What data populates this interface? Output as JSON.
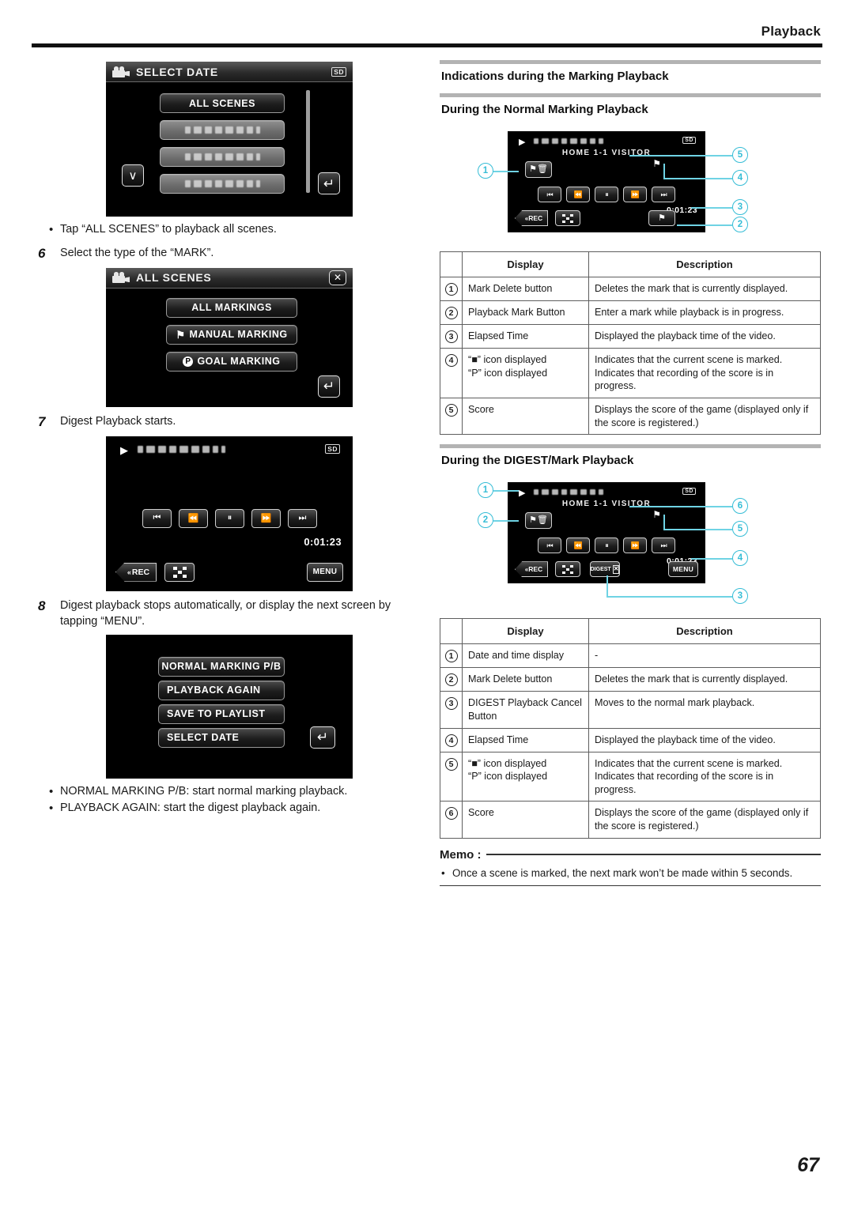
{
  "header": {
    "title": "Playback"
  },
  "footer": {
    "page_number": "67"
  },
  "left_column": {
    "screen_select_date": {
      "title": "SELECT DATE",
      "sd_badge": "SD",
      "all_scenes_label": "ALL SCENES",
      "down_arrow": "∨",
      "return_icon": "return-arrow"
    },
    "note_all_scenes": "Tap “ALL SCENES” to playback all scenes.",
    "step6": {
      "number": "6",
      "text": "Select the type of the “MARK”."
    },
    "screen_all_scenes": {
      "title": "ALL SCENES",
      "close_icon": "✕",
      "buttons": [
        "ALL MARKINGS",
        "MANUAL MARKING",
        "GOAL MARKING"
      ],
      "manual_icon": "flag-icon",
      "goal_icon": "P"
    },
    "step7": {
      "number": "7",
      "text": "Digest Playback starts."
    },
    "screen_digest_playback": {
      "sd_badge": "SD",
      "play_icon": "▶",
      "transport": [
        "⏮",
        "⏪",
        "⏸",
        "⏩",
        "⏭"
      ],
      "elapsed_time": "0:01:23",
      "rec_label": "REC",
      "menu_label": "MENU",
      "grid_icon": "index-grid-icon"
    },
    "step8": {
      "number": "8",
      "text": "Digest playback stops automatically, or display the next screen by tapping “MENU”."
    },
    "screen_after_digest": {
      "buttons": [
        "NORMAL MARKING P/B",
        "PLAYBACK AGAIN",
        "SAVE TO PLAYLIST",
        "SELECT DATE"
      ],
      "return_icon": "return-arrow"
    },
    "notes": [
      "NORMAL MARKING P/B: start normal marking playback.",
      "PLAYBACK AGAIN: start the digest playback again."
    ]
  },
  "right_column": {
    "heading_main": "Indications during the Marking Playback",
    "heading_normal": "During the Normal Marking Playback",
    "heading_digest": "During the DIGEST/Mark Playback",
    "screen_normal": {
      "play_icon": "▶",
      "sd_badge": "SD",
      "score_text": "HOME  1-1  VISITOR",
      "elapsed_time": "0:01:23",
      "rec_label": "REC",
      "transport": [
        "⏮",
        "⏪",
        "⏸",
        "⏩",
        "⏭"
      ],
      "callouts": [
        "1",
        "2",
        "3",
        "4",
        "5"
      ]
    },
    "screen_digest": {
      "play_icon": "▶",
      "sd_badge": "SD",
      "score_text": "HOME  1-1  VISITOR",
      "elapsed_time": "0:01:23",
      "rec_label": "REC",
      "digest_label": "DIGEST",
      "digest_cancel_icon": "✕",
      "menu_label": "MENU",
      "transport": [
        "⏮",
        "⏪",
        "⏸",
        "⏩",
        "⏭"
      ],
      "callouts": [
        "1",
        "2",
        "3",
        "4",
        "5",
        "6"
      ]
    },
    "table_normal": {
      "columns": [
        "",
        "Display",
        "Description"
      ],
      "rows": [
        {
          "idx": "1",
          "display": "Mark Delete button",
          "description": "Deletes the mark that is currently displayed."
        },
        {
          "idx": "2",
          "display": "Playback Mark Button",
          "description": "Enter a mark while playback is in progress."
        },
        {
          "idx": "3",
          "display": "Elapsed Time",
          "description": "Displayed the playback time of the video."
        },
        {
          "idx": "4",
          "display_html": "“■” icon displayed<br>“P” icon displayed",
          "description": "Indicates that the current scene is marked. Indicates that recording of the score is in progress."
        },
        {
          "idx": "5",
          "display": "Score",
          "description": "Displays the score of the game (displayed only if the score is registered.)"
        }
      ]
    },
    "table_digest": {
      "columns": [
        "",
        "Display",
        "Description"
      ],
      "rows": [
        {
          "idx": "1",
          "display": "Date and time display",
          "description": "-"
        },
        {
          "idx": "2",
          "display": "Mark Delete button",
          "description": "Deletes the mark that is currently displayed."
        },
        {
          "idx": "3",
          "display": "DIGEST Playback Cancel Button",
          "description": "Moves to the normal mark playback."
        },
        {
          "idx": "4",
          "display": "Elapsed Time",
          "description": "Displayed the playback time of the video."
        },
        {
          "idx": "5",
          "display_html": "“■” icon displayed<br>“P” icon displayed",
          "description": "Indicates that the current scene is marked. Indicates that recording of the score is in progress."
        },
        {
          "idx": "6",
          "display": "Score",
          "description": "Displays the score of the game (displayed only if the score is registered.)"
        }
      ]
    },
    "memo": {
      "label": "Memo :",
      "items": [
        "Once a scene is marked, the next mark won’t be made within 5 seconds."
      ]
    }
  },
  "colors": {
    "callout": "#36bdd6",
    "rule": "#111111",
    "heading_bar": "#b3b3b3"
  }
}
